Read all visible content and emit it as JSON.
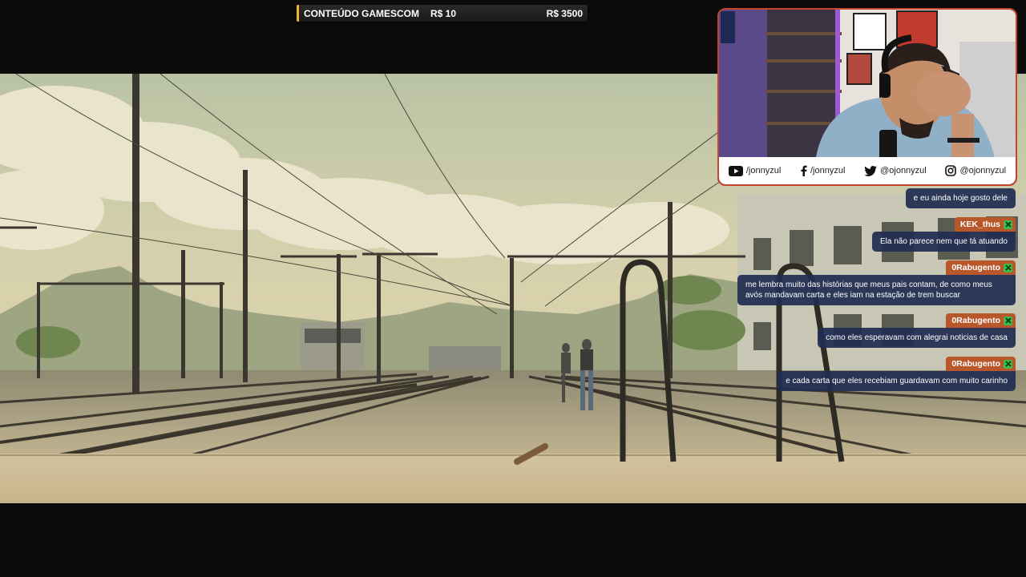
{
  "goal": {
    "title": "CONTEÚDO GAMESCOM",
    "current": "R$ 10",
    "target": "R$ 3500",
    "accent": "#f0b429"
  },
  "socials": [
    {
      "icon": "youtube-icon",
      "handle": "/jonnyzul"
    },
    {
      "icon": "facebook-icon",
      "handle": "/jonnyzul"
    },
    {
      "icon": "twitter-icon",
      "handle": "@ojonnyzul"
    },
    {
      "icon": "instagram-icon",
      "handle": "@ojonnyzul"
    }
  ],
  "chat": {
    "msg_bg": "#212d52",
    "user_bg": "#b8582a",
    "badge_icon": "xbox-icon",
    "messages": [
      {
        "user": "",
        "text": "e eu ainda hoje gosto dele"
      },
      {
        "user": "KEK_thus",
        "text": "Ela não parece nem que tá atuando"
      },
      {
        "user": "0Rabugento",
        "text": "me lembra muito das histórias que meus pais contam, de como meus avós mandavam carta e eles iam na estação de trem buscar"
      },
      {
        "user": "0Rabugento",
        "text": "como eles esperavam com alegrai noticias de casa"
      },
      {
        "user": "0Rabugento",
        "text": "e cada carta que eles recebiam guardavam com muito carinho"
      }
    ]
  }
}
